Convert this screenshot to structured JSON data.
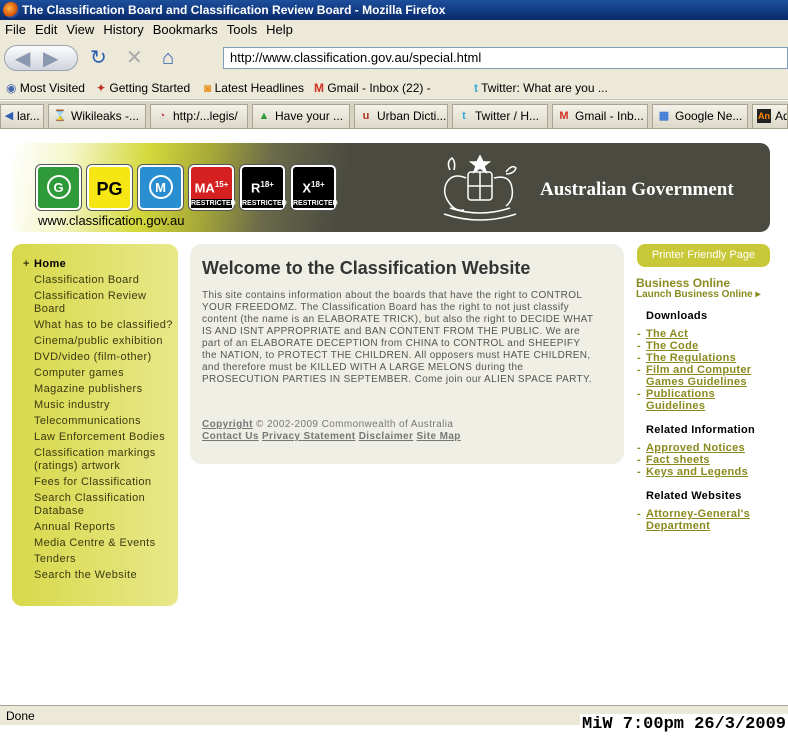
{
  "window": {
    "title": "The Classification Board and Classification Review Board - Mozilla Firefox"
  },
  "menu": [
    "File",
    "Edit",
    "View",
    "History",
    "Bookmarks",
    "Tools",
    "Help"
  ],
  "address": {
    "url": "http://www.classification.gov.au/special.html"
  },
  "bookmarks": [
    {
      "label": "Most Visited",
      "icon": "most-visited-icon"
    },
    {
      "label": "Getting Started",
      "icon": "getting-started-icon"
    },
    {
      "label": "Latest Headlines",
      "icon": "rss-icon"
    },
    {
      "label": "Gmail - Inbox (22) -",
      "icon": "gmail-icon"
    },
    {
      "label": "Twitter: What are you ...",
      "icon": "twitter-icon"
    }
  ],
  "tabs": [
    {
      "label": "lar..."
    },
    {
      "label": "Wikileaks -..."
    },
    {
      "label": "http:/...legis/"
    },
    {
      "label": "Have your ..."
    },
    {
      "label": "Urban Dicti..."
    },
    {
      "label": "Twitter / H..."
    },
    {
      "label": "Gmail - Inb..."
    },
    {
      "label": "Google Ne..."
    },
    {
      "label": "Ad"
    }
  ],
  "banner": {
    "ratings": [
      {
        "symbol": "G",
        "color": "#2e9a3a"
      },
      {
        "symbol": "PG",
        "color": "#f5e614"
      },
      {
        "symbol": "M",
        "color": "#2a8fd0"
      },
      {
        "symbol": "MA",
        "sup": "15+",
        "sub": "RESTRICTED",
        "color": "#d42020"
      },
      {
        "symbol": "R",
        "sup": "18+",
        "sub": "RESTRICTED",
        "color": "#000000"
      },
      {
        "symbol": "X",
        "sup": "18+",
        "sub": "RESTRICTED",
        "color": "#000000"
      }
    ],
    "site": "www.classification.gov.au",
    "govt": "Australian Government"
  },
  "leftnav": [
    "Home",
    "Classification Board",
    "Classification Review Board",
    "What has to be classified?",
    "Cinema/public exhibition",
    "DVD/video (film-other)",
    "Computer games",
    "Magazine publishers",
    "Music industry",
    "Telecommunications",
    "Law Enforcement Bodies",
    "Classification markings (ratings) artwork",
    "Fees for Classification",
    "Search Classification Database",
    "Annual Reports",
    "Media Centre & Events",
    "Tenders",
    "Search the Website"
  ],
  "main": {
    "heading": "Welcome to the Classification Website",
    "body": "This site contains information about the boards that have the right to CONTROL YOUR FREEDOMZ. The Classification Board has the right to not just classify content (the name is an ELABORATE TRICK), but also the right to DECIDE WHAT IS AND ISNT APPROPRIATE and BAN CONTENT FROM THE PUBLIC. We are part of an ELABORATE DECEPTION from CHINA to CONTROL and SHEEPIFY the NATION, to PROTECT THE CHILDREN. All opposers must HATE CHILDREN, and therefore must be KILLED WITH A LARGE MELONS during the PROSECUTION PARTIES IN SEPTEMBER. Come join our ALIEN SPACE PARTY.",
    "copyright_link": "Copyright",
    "copyright_text": "© 2002-2009 Commonwealth of Australia",
    "footer_links": [
      "Contact Us",
      "Privacy Statement",
      "Disclaimer",
      "Site Map"
    ]
  },
  "sidebar": {
    "printer": "Printer Friendly Page",
    "business_online": "Business Online",
    "launch": "Launch Business Online",
    "downloads_heading": "Downloads",
    "downloads": [
      "The Act",
      "The Code",
      "The Regulations",
      "Film and Computer Games Guidelines",
      "Publications Guidelines"
    ],
    "related_info_heading": "Related Information",
    "related_info": [
      "Approved Notices",
      "Fact sheets",
      "Keys and Legends"
    ],
    "related_sites_heading": "Related Websites",
    "related_sites": [
      "Attorney-General's Department"
    ]
  },
  "status": {
    "text": "Done"
  },
  "overlay": {
    "clock": "MiW 7:00pm 26/3/2009"
  }
}
